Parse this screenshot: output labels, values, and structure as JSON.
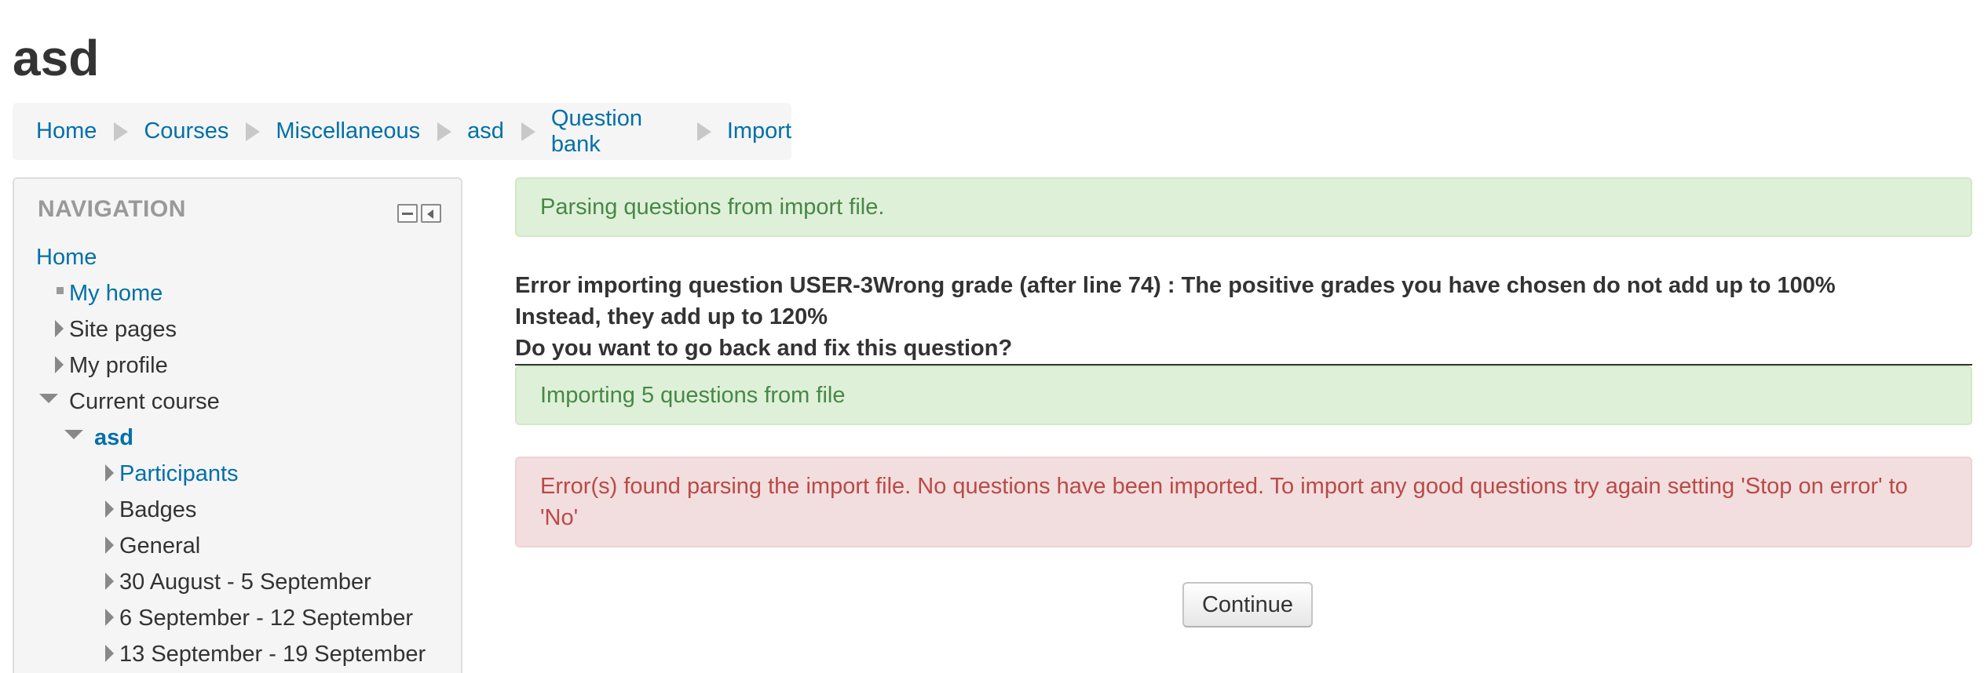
{
  "page": {
    "title": "asd"
  },
  "breadcrumb": [
    {
      "label": "Home"
    },
    {
      "label": "Courses"
    },
    {
      "label": "Miscellaneous"
    },
    {
      "label": "asd"
    },
    {
      "label": "Question bank"
    },
    {
      "label": "Import"
    }
  ],
  "navigation": {
    "header": "NAVIGATION",
    "items": [
      {
        "label": "Home",
        "link": true,
        "icon": "none"
      },
      {
        "label": "My home",
        "link": true,
        "icon": "square-bullet"
      },
      {
        "label": "Site pages",
        "link": false,
        "icon": "triangle-right"
      },
      {
        "label": "My profile",
        "link": false,
        "icon": "triangle-right"
      },
      {
        "label": "Current course",
        "link": false,
        "icon": "triangle-down"
      },
      {
        "label": "asd",
        "link": true,
        "bold": true,
        "icon": "triangle-down"
      },
      {
        "label": "Participants",
        "link": true,
        "icon": "triangle-right"
      },
      {
        "label": "Badges",
        "link": false,
        "icon": "triangle-right"
      },
      {
        "label": "General",
        "link": false,
        "icon": "triangle-right"
      },
      {
        "label": "30 August - 5 September",
        "link": false,
        "icon": "triangle-right"
      },
      {
        "label": "6 September - 12 September",
        "link": false,
        "icon": "triangle-right"
      },
      {
        "label": "13 September - 19 September",
        "link": false,
        "icon": "triangle-right"
      }
    ]
  },
  "main": {
    "parsing_notice": "Parsing questions from import file.",
    "error_line1": "Error importing question USER-3Wrong grade (after line 74) : The positive grades you have chosen do not add up to 100%",
    "error_line2": "Instead, they add up to 120%",
    "error_line3": "Do you want to go back and fix this question?",
    "importing_notice": "Importing 5 questions from file",
    "error_alert": "Error(s) found parsing the import file. No questions have been imported. To import any good questions try again setting 'Stop on error' to 'No'",
    "continue_label": "Continue"
  },
  "colors": {
    "link": "#0070a8",
    "success_bg": "#dff0d8",
    "success_text": "#468847",
    "error_bg": "#f2dede",
    "error_text": "#b94a48"
  }
}
